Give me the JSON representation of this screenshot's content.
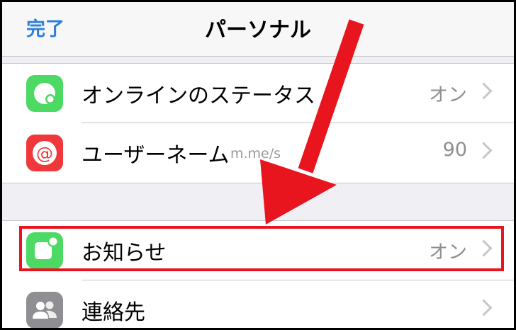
{
  "navbar": {
    "done": "完了",
    "title": "パーソナル"
  },
  "items": [
    {
      "label": "オンラインのステータス",
      "value": "オン",
      "icon": "status-icon"
    },
    {
      "label": "ユーザーネーム",
      "sub": "m.me/s",
      "value": "90",
      "icon": "at-sign-icon"
    },
    {
      "label": "お知らせ",
      "value": "オン",
      "icon": "notification-icon"
    },
    {
      "label": "連絡先",
      "value": "",
      "icon": "contacts-icon"
    }
  ],
  "colors": {
    "accent": "#2f7fd8",
    "green": "#4cd964",
    "red": "#f0373b",
    "gray": "#8e8e93",
    "annotation": "#e8141e"
  }
}
